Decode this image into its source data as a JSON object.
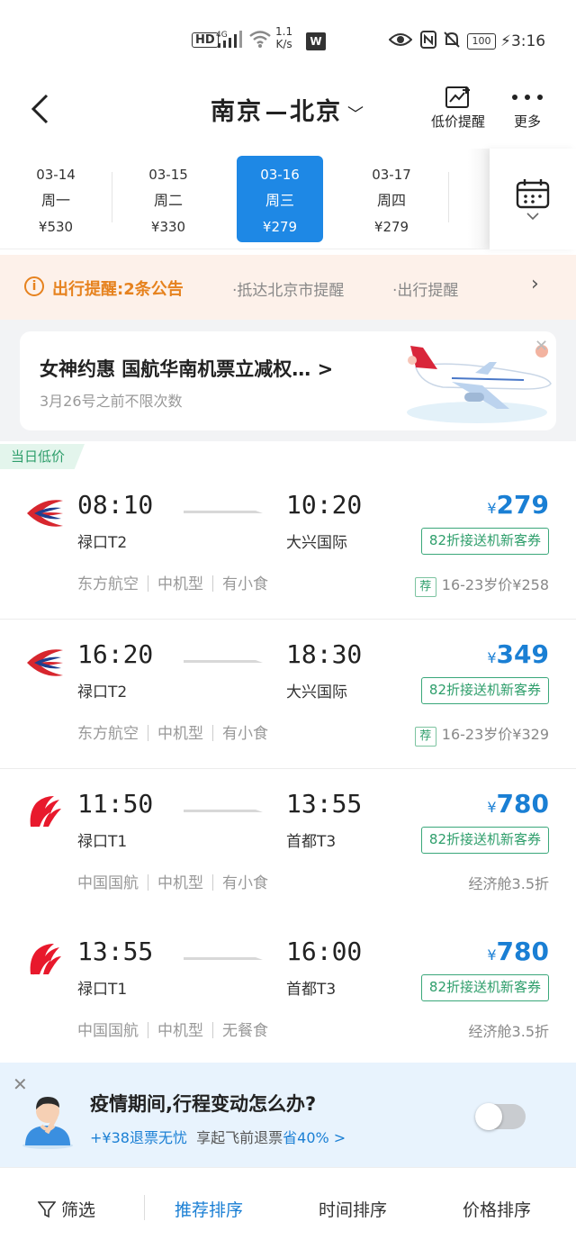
{
  "status_bar": {
    "hd": "HD",
    "network": "4G",
    "speed_value": "1.1",
    "speed_unit": "K/s",
    "battery": "100",
    "time": "3:16"
  },
  "header": {
    "origin": "南京",
    "destination": "北京",
    "low_price_alert_label": "低价提醒",
    "more_label": "更多"
  },
  "dates": [
    {
      "date": "03-14",
      "weekday": "周一",
      "price": "¥530",
      "selected": false
    },
    {
      "date": "03-15",
      "weekday": "周二",
      "price": "¥330",
      "selected": false
    },
    {
      "date": "03-16",
      "weekday": "周三",
      "price": "¥279",
      "selected": true
    },
    {
      "date": "03-17",
      "weekday": "周四",
      "price": "¥279",
      "selected": false
    }
  ],
  "notice": {
    "title": "出行提醒:",
    "count": "2条公告",
    "links": [
      "·抵达北京市提醒",
      "·出行提醒"
    ]
  },
  "promo": {
    "title": "女神约惠 国航华南机票立减权… >",
    "subtitle": "3月26号之前不限次数"
  },
  "section_tag": "当日低价",
  "flights": [
    {
      "airline": "东方航空",
      "logo": "china-eastern",
      "dep_time": "08:10",
      "dep_airport": "禄口T2",
      "arr_time": "10:20",
      "arr_airport": "大兴国际",
      "currency": "¥",
      "price": "279",
      "coupon": "82折接送机新客券",
      "aircraft": "中机型",
      "meal": "有小食",
      "extra_tag": "荐",
      "extra": "16-23岁价¥258"
    },
    {
      "airline": "东方航空",
      "logo": "china-eastern",
      "dep_time": "16:20",
      "dep_airport": "禄口T2",
      "arr_time": "18:30",
      "arr_airport": "大兴国际",
      "currency": "¥",
      "price": "349",
      "coupon": "82折接送机新客券",
      "aircraft": "中机型",
      "meal": "有小食",
      "extra_tag": "荐",
      "extra": "16-23岁价¥329"
    },
    {
      "airline": "中国国航",
      "logo": "air-china",
      "dep_time": "11:50",
      "dep_airport": "禄口T1",
      "arr_time": "13:55",
      "arr_airport": "首都T3",
      "currency": "¥",
      "price": "780",
      "coupon": "82折接送机新客券",
      "aircraft": "中机型",
      "meal": "有小食",
      "extra_tag": "",
      "extra": "经济舱3.5折"
    },
    {
      "airline": "中国国航",
      "logo": "air-china",
      "dep_time": "13:55",
      "dep_airport": "禄口T1",
      "arr_time": "16:00",
      "arr_airport": "首都T3",
      "currency": "¥",
      "price": "780",
      "coupon": "82折接送机新客券",
      "aircraft": "中机型",
      "meal": "无餐食",
      "extra_tag": "",
      "extra": "经济舱3.5折"
    }
  ],
  "epidemic": {
    "title": "疫情期间,行程变动怎么办?",
    "sub_highlight": "+¥38退票无忧",
    "sub_text": "享起飞前退票",
    "sub_save": "省40% >"
  },
  "bottom_bar": {
    "filter": "筛选",
    "recommended": "推荐排序",
    "time": "时间排序",
    "price": "价格排序"
  },
  "colors": {
    "accent": "#1e88e5",
    "price": "#1a7fd4",
    "coupon": "#2e9e6b",
    "notice": "#e6821e",
    "china_eastern_red": "#d7262e",
    "china_eastern_blue": "#1f3f8f",
    "air_china_red": "#e8192c"
  }
}
